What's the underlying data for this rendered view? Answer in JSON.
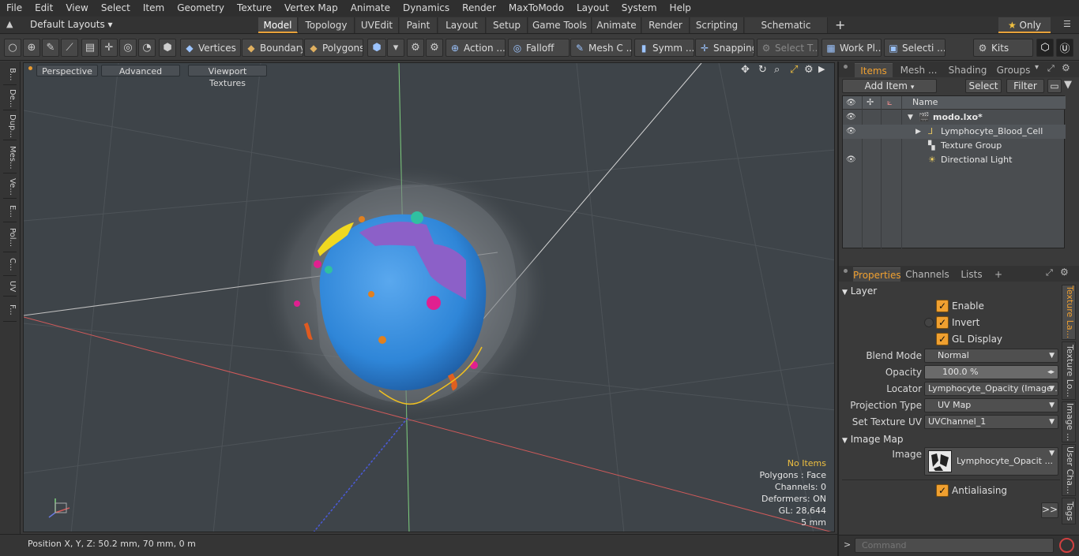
{
  "menu": [
    "File",
    "Edit",
    "View",
    "Select",
    "Item",
    "Geometry",
    "Texture",
    "Vertex Map",
    "Animate",
    "Dynamics",
    "Render",
    "MaxToModo",
    "Layout",
    "System",
    "Help"
  ],
  "layouts": {
    "dropdown": "Default Layouts",
    "tabs": [
      "Model",
      "Topology",
      "UVEdit",
      "Paint",
      "Layout",
      "Setup",
      "Game Tools",
      "Animate",
      "Render",
      "Scripting",
      "Schematic Fusion"
    ],
    "active_tab": "Model",
    "only_label": "Only"
  },
  "toolbar": {
    "vertices": "Vertices",
    "boundary": "Boundary",
    "polygons": "Polygons",
    "action": "Action",
    "falloff": "Falloff",
    "mesh": "Mesh C ...",
    "symm": "Symm ...",
    "snapping": "Snapping",
    "select_t": "Select T...",
    "work_pl": "Work Pl...",
    "selecti": "Selecti ...",
    "kits": "Kits"
  },
  "left_tabs": [
    "B...",
    "De...",
    "Dup...",
    "Mes...",
    "Ve...",
    "E...",
    "Pol...",
    "C...",
    "UV",
    "F..."
  ],
  "viewport": {
    "perspective": "Perspective",
    "advanced": "Advanced",
    "textures": "Viewport Textures",
    "info": {
      "no_items": "No Items",
      "polygons": "Polygons : Face",
      "channels": "Channels: 0",
      "deformers": "Deformers: ON",
      "gl": "GL: 28,644",
      "scale": "5 mm"
    }
  },
  "status": {
    "position": "Position X, Y, Z:   50.2 mm, 70 mm, 0 m"
  },
  "items_panel": {
    "tabs": [
      "Items",
      "Mesh ...",
      "Shading",
      "Groups"
    ],
    "active": "Items",
    "add_item": "Add Item",
    "select": "Select",
    "filter": "Filter",
    "col_name": "Name",
    "rows": [
      {
        "name": "modo.lxo*",
        "indent": 0
      },
      {
        "name": "Lymphocyte_Blood_Cell",
        "indent": 1
      },
      {
        "name": "Texture Group",
        "indent": 1
      },
      {
        "name": "Directional Light",
        "indent": 1
      }
    ]
  },
  "properties": {
    "tabs": [
      "Properties",
      "Channels",
      "Lists",
      "+"
    ],
    "active": "Properties",
    "layer_section": "Layer",
    "enable": "Enable",
    "invert": "Invert",
    "gl_display": "GL Display",
    "blend_mode_label": "Blend Mode",
    "blend_mode": "Normal",
    "opacity_label": "Opacity",
    "opacity": "100.0 %",
    "locator_label": "Locator",
    "locator": "Lymphocyte_Opacity (Image ...",
    "projection_label": "Projection Type",
    "projection": "UV Map",
    "set_uv_label": "Set Texture UV",
    "set_uv": "UVChannel_1",
    "image_map_section": "Image Map",
    "image_label": "Image",
    "image": "Lymphocyte_Opacit ...",
    "antialiasing": "Antialiasing",
    "more": ">>"
  },
  "side_tabs": [
    "Texture La...",
    "Texture Lo...",
    "Image ...",
    "User Cha...",
    "Tags"
  ],
  "command": {
    "placeholder": "Command"
  }
}
